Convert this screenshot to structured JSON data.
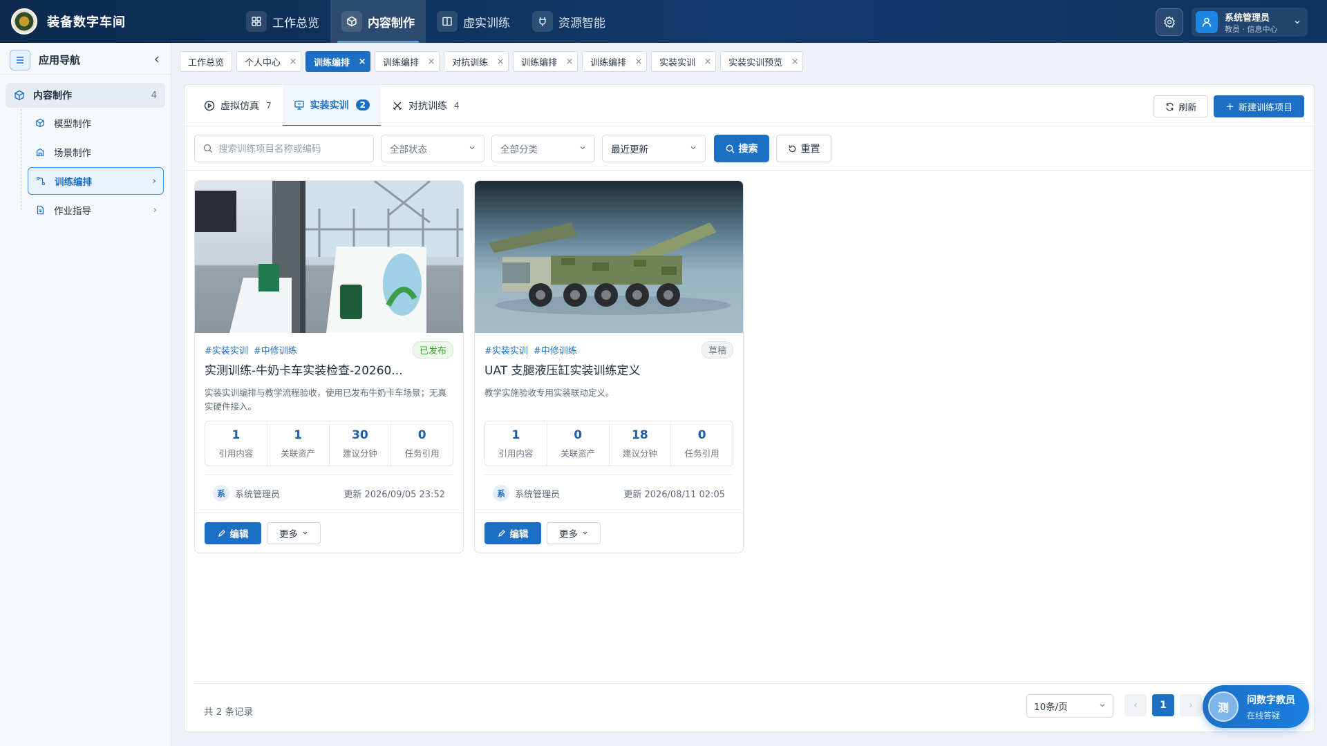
{
  "app": {
    "title": "装备数字车间"
  },
  "nav": [
    {
      "label": "工作总览",
      "icon": "grid-icon"
    },
    {
      "label": "内容制作",
      "icon": "cube-icon",
      "active": true
    },
    {
      "label": "虚实训练",
      "icon": "book-icon"
    },
    {
      "label": "资源智能",
      "icon": "plug-icon"
    }
  ],
  "user": {
    "name": "系统管理员",
    "role": "教员 · 信息中心"
  },
  "sidebar": {
    "title": "应用导航",
    "group": {
      "label": "内容制作",
      "count": "4"
    },
    "items": [
      {
        "label": "模型制作",
        "icon": "cube-icon"
      },
      {
        "label": "场景制作",
        "icon": "building-icon"
      },
      {
        "label": "训练编排",
        "icon": "flow-icon",
        "active": true
      },
      {
        "label": "作业指导",
        "icon": "document-icon"
      }
    ]
  },
  "tabs": [
    {
      "label": "工作总览",
      "closable": false
    },
    {
      "label": "个人中心",
      "closable": true
    },
    {
      "label": "训练编排",
      "closable": true,
      "active": true
    },
    {
      "label": "训练编排",
      "closable": true
    },
    {
      "label": "对抗训练",
      "closable": true
    },
    {
      "label": "训练编排",
      "closable": true
    },
    {
      "label": "训练编排",
      "closable": true
    },
    {
      "label": "实装实训",
      "closable": true
    },
    {
      "label": "实装实训预览",
      "closable": true
    }
  ],
  "segments": [
    {
      "label": "虚拟仿真",
      "count": "7"
    },
    {
      "label": "实装实训",
      "count": "2",
      "active": true
    },
    {
      "label": "对抗训练",
      "count": "4"
    }
  ],
  "toolbar": {
    "refresh": "刷新",
    "new": "新建训练项目"
  },
  "filters": {
    "search_placeholder": "搜索训练项目名称或编码",
    "status": "全部状态",
    "category": "全部分类",
    "sort": "最近更新",
    "search_btn": "搜索",
    "reset_btn": "重置"
  },
  "cards": [
    {
      "tags": [
        "#实装实训",
        "#中修训练"
      ],
      "status": "已发布",
      "title": "实测训练-牛奶卡车实装检查-20260...",
      "desc": "实装实训编排与教学流程验收，使用已发布牛奶卡车场景；无真实硬件接入。",
      "stats": [
        {
          "value": "1",
          "label": "引用内容"
        },
        {
          "value": "1",
          "label": "关联资产"
        },
        {
          "value": "30",
          "label": "建议分钟"
        },
        {
          "value": "0",
          "label": "任务引用"
        }
      ],
      "avatar": "系",
      "author": "系统管理员",
      "updated": "更新 2026/09/05 23:52",
      "edit": "编辑",
      "more": "更多"
    },
    {
      "tags": [
        "#实装实训",
        "#中修训练"
      ],
      "status": "草稿",
      "title": "UAT 支腿液压缸实装训练定义",
      "desc": "教学实施验收专用实装联动定义。",
      "stats": [
        {
          "value": "1",
          "label": "引用内容"
        },
        {
          "value": "0",
          "label": "关联资产"
        },
        {
          "value": "18",
          "label": "建议分钟"
        },
        {
          "value": "0",
          "label": "任务引用"
        }
      ],
      "avatar": "系",
      "author": "系统管理员",
      "updated": "更新 2026/08/11 02:05",
      "edit": "编辑",
      "more": "更多"
    }
  ],
  "pagination": {
    "total": "共 2 条记录",
    "page_size": "10条/页",
    "prev": "‹",
    "current": "1",
    "next": "›"
  },
  "assistant": {
    "avatar": "测",
    "title": "问数字教员",
    "subtitle": "在线答疑"
  },
  "colors": {
    "primary": "#1d6fc5",
    "topbar": "#123a6b",
    "published": "#3aa235"
  }
}
